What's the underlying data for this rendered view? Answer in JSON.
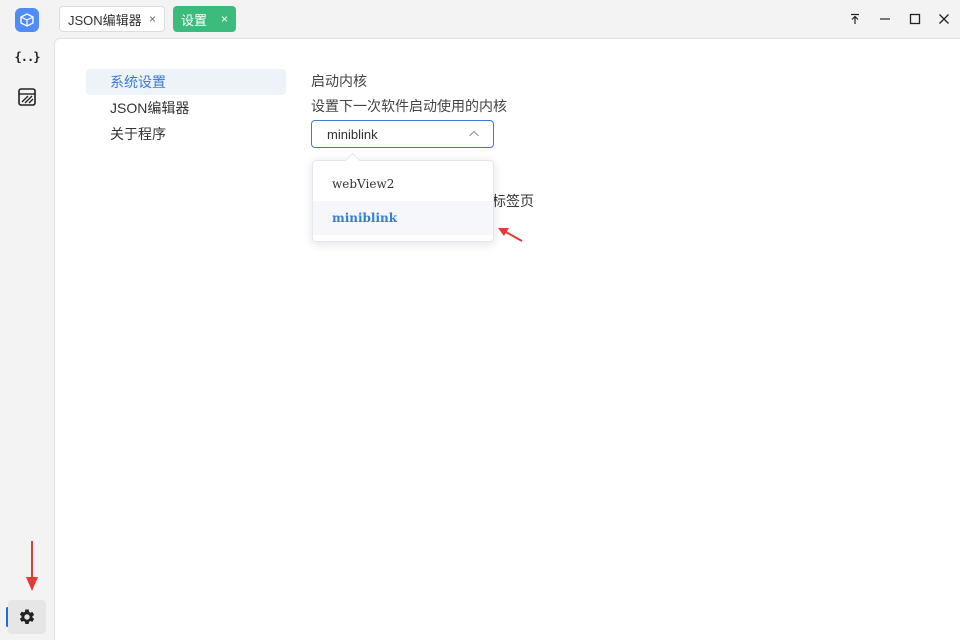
{
  "titlebar": {
    "tabs": [
      {
        "label": "JSON编辑器",
        "close": "×"
      },
      {
        "label": "设置",
        "close": "×"
      }
    ]
  },
  "sidebar": {
    "items": [
      {
        "icon": "cube-logo-icon"
      },
      {
        "icon": "json-braces-icon",
        "glyph": "{..}"
      },
      {
        "icon": "image-editor-icon"
      },
      {
        "icon": "gear-icon",
        "active": true
      }
    ]
  },
  "settings_nav": {
    "items": [
      {
        "label": "系统设置",
        "active": true
      },
      {
        "label": "JSON编辑器"
      },
      {
        "label": "关于程序"
      }
    ]
  },
  "kernel": {
    "title": "启动内核",
    "description": "设置下一次软件启动使用的内核",
    "selected": "miniblink",
    "options": [
      "webView2",
      "miniblink"
    ]
  },
  "partially_hidden_text": "标签页",
  "colors": {
    "accent": "#3a7bd5",
    "tab_active": "#3dbb7d",
    "annotation_arrow": "#e53935"
  }
}
